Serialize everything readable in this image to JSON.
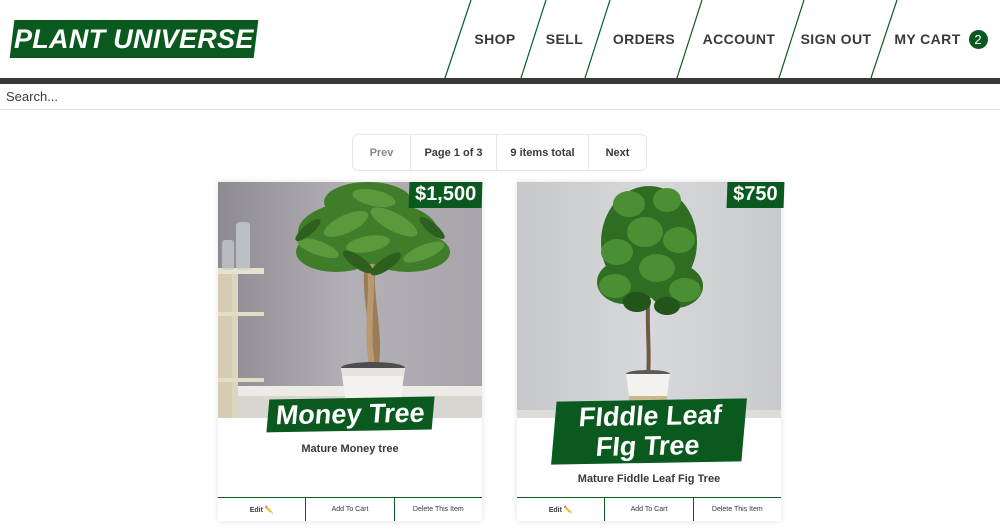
{
  "brand": {
    "name": "PLANT UNIVERSE",
    "accent": "#0a5a1f",
    "dark": "#393939"
  },
  "nav": {
    "items": [
      {
        "label": "SHOP"
      },
      {
        "label": "SELL"
      },
      {
        "label": "ORDERS"
      },
      {
        "label": "ACCOUNT"
      },
      {
        "label": "SIGN OUT"
      }
    ],
    "cart": {
      "label": "MY CART",
      "count": "2"
    }
  },
  "search": {
    "placeholder": "Search..."
  },
  "pagination": {
    "prev": "Prev",
    "page": "Page 1 of 3",
    "total": "9 items total",
    "next": "Next"
  },
  "products": [
    {
      "title": "Money Tree",
      "price": "$1,500",
      "description": "Mature Money tree",
      "actions": {
        "edit": "Edit ✏️",
        "add": "Add To Cart",
        "delete": "Delete This Item"
      }
    },
    {
      "title": "FIddle Leaf FIg Tree",
      "price": "$750",
      "description": "Mature Fiddle Leaf Fig Tree",
      "actions": {
        "edit": "Edit ✏️",
        "add": "Add To Cart",
        "delete": "Delete This Item"
      }
    }
  ]
}
